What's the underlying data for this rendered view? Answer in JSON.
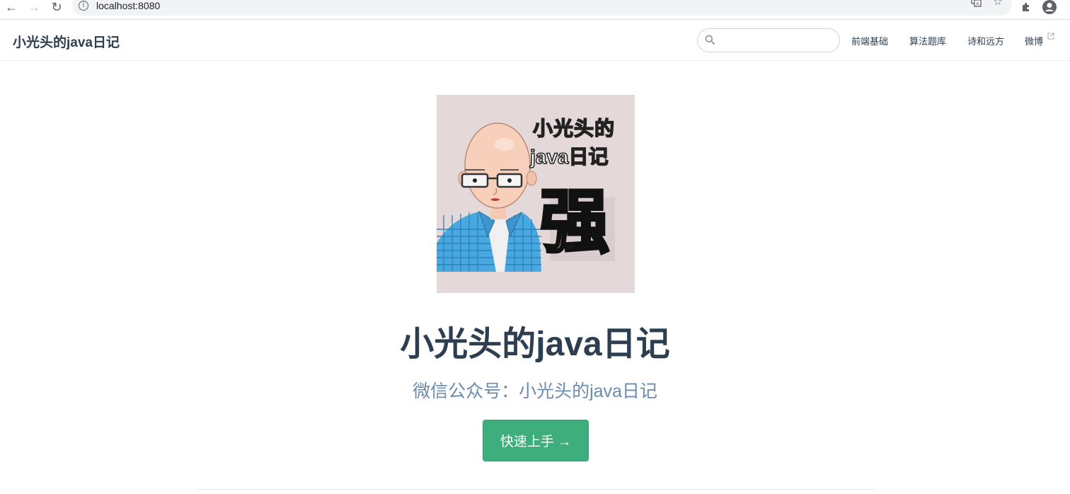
{
  "browser": {
    "url": "localhost:8080",
    "back_icon": "arrow-left-icon",
    "forward_icon": "arrow-right-icon",
    "reload_icon": "reload-icon"
  },
  "navbar": {
    "site_name": "小光头的java日记",
    "search_placeholder": "",
    "links": [
      {
        "label": "前端基础"
      },
      {
        "label": "算法题库"
      },
      {
        "label": "诗和远方"
      },
      {
        "label": "微博",
        "external": true
      }
    ]
  },
  "hero": {
    "image_text_line1": "小光头的",
    "image_text_line2": "java日记",
    "image_big_char": "强",
    "title": "小光头的java日记",
    "description": "微信公众号：小光头的java日记",
    "action_label": "快速上手 →"
  },
  "colors": {
    "accent": "#3eaf7c",
    "text": "#2c3e50",
    "description": "#6a8bad",
    "image_bg": "#e5d8d8"
  }
}
